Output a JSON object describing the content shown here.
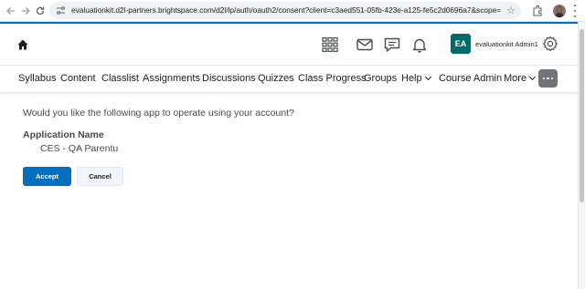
{
  "browser": {
    "url": "evaluationkit.d2l-partners.brightspace.com/d2l/lp/auth/oauth2/consent?client=c3aed551-05fb-423e-a125-fe5c2d0696a7&scope=orgunits%3acourse%..."
  },
  "minibar": {
    "avatar_initials": "EA",
    "username": "evaluationkit Admin1",
    "avatar_color": "#006b6b"
  },
  "navbar": {
    "items": [
      {
        "label": "Syllabus"
      },
      {
        "label": "Content"
      },
      {
        "label": "Classlist"
      },
      {
        "label": "Assignments"
      },
      {
        "label": "Discussions"
      },
      {
        "label": "Quizzes"
      },
      {
        "label": "Class Progress"
      },
      {
        "label": "Groups"
      },
      {
        "label": "Help"
      },
      {
        "label": "Course Admin"
      },
      {
        "label": "More"
      }
    ]
  },
  "consent": {
    "question": "Would you like the following app to operate using your account?",
    "app_name_label": "Application Name",
    "app_name_value": "CES - QA Parentu",
    "accept_label": "Accept",
    "cancel_label": "Cancel"
  },
  "colors": {
    "accent": "#006fbf",
    "more_button": "#6e7477"
  }
}
